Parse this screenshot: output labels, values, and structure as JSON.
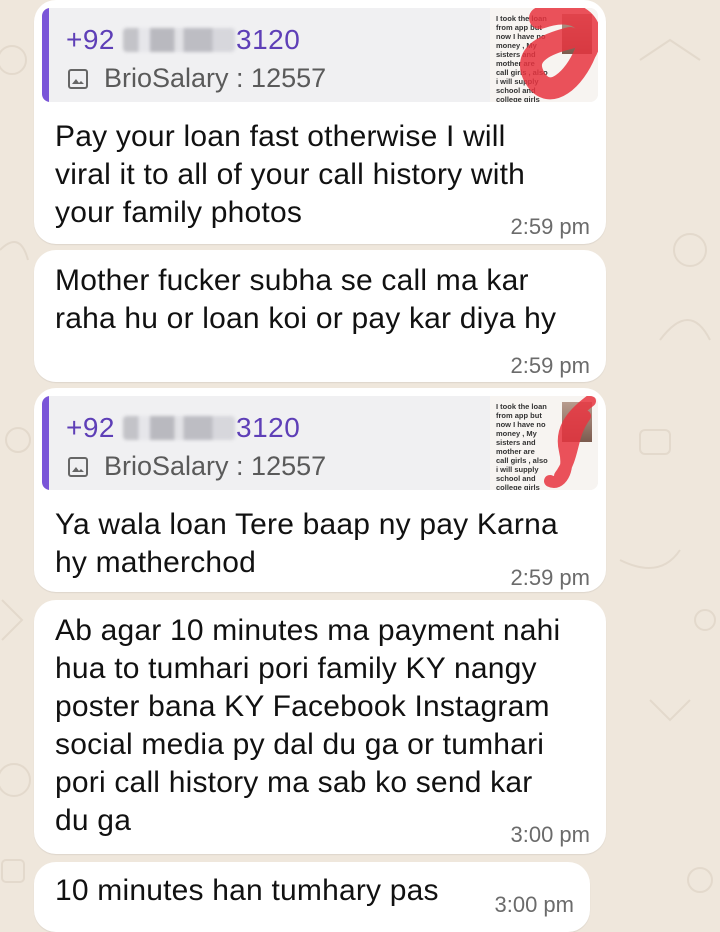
{
  "colors": {
    "background": "#efe7dc",
    "bubble": "#ffffff",
    "quote_accent": "#7a55d8",
    "quote_phone_text": "#5e3fb7",
    "scribble": "#e8343f"
  },
  "messages": [
    {
      "quote": {
        "phone_prefix": "+92",
        "phone_suffix": "3120",
        "source": "BrioSalary :  12557",
        "icon": "image-icon"
      },
      "thumbnail_text": "I took the loan\nfrom app but\nnow I have no\nmoney , My\nsisters and\nmother are\ncall girls , also\ni will supply\nschool and\ncollege girls",
      "lines": [
        "Pay your loan fast otherwise I will",
        "viral it to all of your call history with",
        "your family photos"
      ],
      "time": "2:59 pm"
    },
    {
      "lines": [
        "Mother fucker subha se call ma kar",
        "raha hu or loan koi or pay kar diya hy"
      ],
      "time": "2:59 pm"
    },
    {
      "quote": {
        "phone_prefix": "+92",
        "phone_suffix": "3120",
        "source": "BrioSalary :  12557",
        "icon": "image-icon"
      },
      "thumbnail_text": "I took the loan\nfrom app but\nnow I have no\nmoney , My\nsisters and\nmother are\ncall girls , also\ni will supply\nschool and\ncollege girls",
      "lines": [
        "Ya wala loan Tere baap ny pay Karna",
        "hy matherchod"
      ],
      "time": "2:59 pm"
    },
    {
      "lines": [
        "Ab agar 10 minutes ma payment nahi",
        "hua to tumhari pori family KY nangy",
        "poster bana KY Facebook Instagram",
        "social media py dal du ga or tumhari",
        "pori call history ma sab ko send kar",
        "du ga"
      ],
      "time": "3:00 pm"
    },
    {
      "lines": [
        "10 minutes han tumhary pas"
      ],
      "time": "3:00 pm"
    }
  ]
}
